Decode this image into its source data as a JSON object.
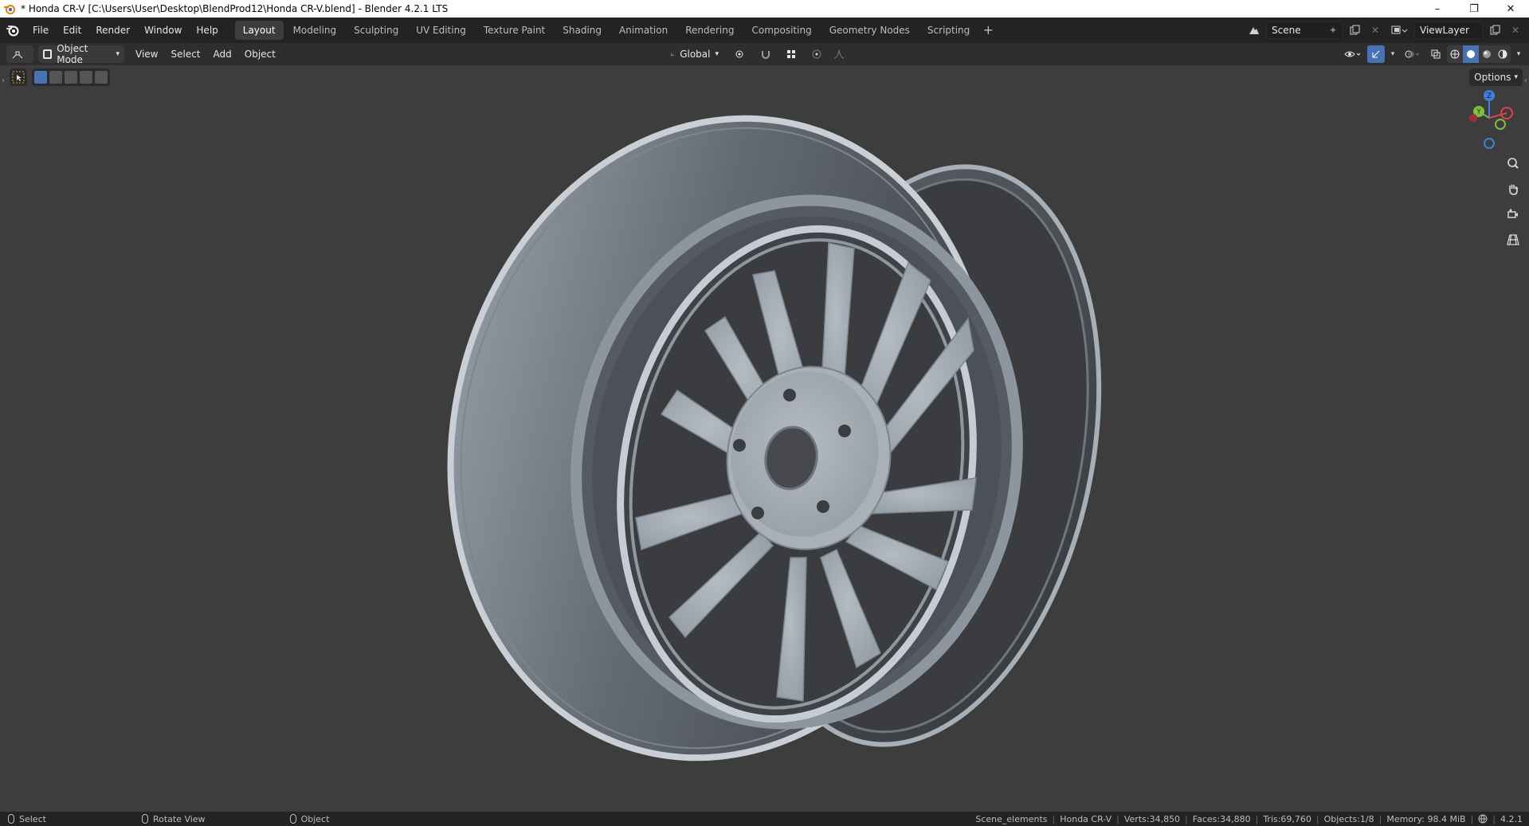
{
  "window": {
    "title": "* Honda CR-V [C:\\Users\\User\\Desktop\\BlendProd12\\Honda CR-V.blend] - Blender 4.2.1 LTS",
    "minimize": "–",
    "maximize": "❐",
    "close": "✕"
  },
  "menu": {
    "items": [
      "File",
      "Edit",
      "Render",
      "Window",
      "Help"
    ]
  },
  "workspaces": {
    "tabs": [
      "Layout",
      "Modeling",
      "Sculpting",
      "UV Editing",
      "Texture Paint",
      "Shading",
      "Animation",
      "Rendering",
      "Compositing",
      "Geometry Nodes",
      "Scripting"
    ],
    "active": "Layout",
    "add": "+"
  },
  "scene": {
    "name": "Scene"
  },
  "view_layer": {
    "name": "ViewLayer"
  },
  "viewport_header": {
    "mode": "Object Mode",
    "menus": [
      "View",
      "Select",
      "Add",
      "Object"
    ],
    "orientation": "Global"
  },
  "viewport": {
    "options_label": "Options",
    "background": "#3d3d3d",
    "gizmo": {
      "z": "Z",
      "y": "Y"
    }
  },
  "statusbar": {
    "hints": [
      "Select",
      "Rotate View",
      "Object"
    ],
    "stats": {
      "collection": "Scene_elements",
      "object": "Honda CR-V",
      "verts": "Verts:34,850",
      "faces": "Faces:34,880",
      "tris": "Tris:69,760",
      "objects": "Objects:1/8",
      "memory": "Memory: 98.4 MiB",
      "version": "4.2.1"
    }
  },
  "colors": {
    "accent": "#4772b3",
    "axis_x": "#e04050",
    "axis_y": "#7fbf3f",
    "axis_z": "#3f7fd8"
  }
}
